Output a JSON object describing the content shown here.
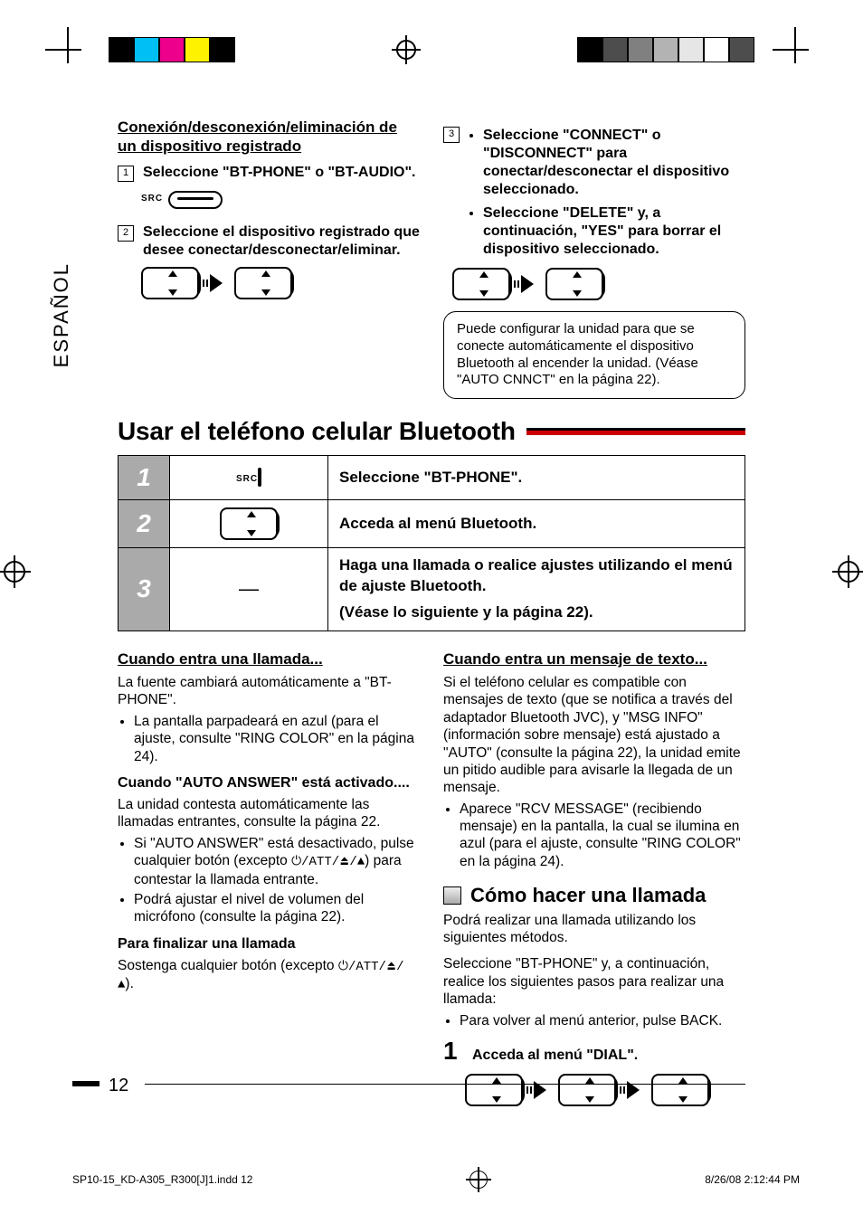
{
  "lang_tab": "ESPAÑOL",
  "top": {
    "left": {
      "heading": "Conexión/desconexión/eliminación de un dispositivo registrado",
      "steps": {
        "1": "Seleccione \"BT-PHONE\" o \"BT-AUDIO\".",
        "2": "Seleccione el dispositivo registrado que desee conectar/desconectar/eliminar."
      },
      "src_label": "SRC"
    },
    "right": {
      "step3": {
        "a": "Seleccione \"CONNECT\" o \"DISCONNECT\" para conectar/desconectar el dispositivo seleccionado.",
        "b": "Seleccione \"DELETE\" y, a continuación, \"YES\" para borrar el dispositivo seleccionado."
      },
      "note": "Puede configurar la unidad para que se conecte automáticamente el dispositivo Bluetooth al encender la unidad. (Véase \"AUTO CNNCT\" en la página 22)."
    }
  },
  "section_title": "Usar el teléfono celular Bluetooth",
  "table": {
    "1": "Seleccione \"BT-PHONE\".",
    "2": "Acceda al menú Bluetooth.",
    "3a": "Haga una llamada o realice ajustes utilizando el menú de ajuste Bluetooth.",
    "3b": "(Véase lo siguiente y la página 22).",
    "src_label": "SRC"
  },
  "lower": {
    "left": {
      "h1": "Cuando entra una llamada...",
      "p1": "La fuente cambiará automáticamente a \"BT-PHONE\".",
      "li1": "La pantalla parpadeará en azul (para el ajuste, consulte \"RING COLOR\" en la página 24).",
      "b2": "Cuando \"AUTO ANSWER\" está activado....",
      "p2": "La unidad contesta automáticamente las llamadas entrantes, consulte la página 22.",
      "li2": "Si \"AUTO ANSWER\" está desactivado, pulse cualquier botón (excepto ",
      "li2_tail": ") para contestar la llamada entrante.",
      "li3": "Podrá ajustar el nivel de volumen del micrófono (consulte la página 22).",
      "b3": "Para finalizar una llamada",
      "p3_head": "Sostenga cualquier botón (excepto ",
      "p3_tail": ").",
      "glyph": "⏻/ATT/⏏/▲"
    },
    "right": {
      "h1": "Cuando entra un mensaje de texto...",
      "p1": "Si el teléfono celular es compatible con mensajes de texto (que se notifica a través del adaptador Bluetooth JVC), y \"MSG INFO\" (información sobre mensaje) está ajustado a \"AUTO\" (consulte la página 22), la unidad emite un pitido audible para avisarle la llegada de un mensaje.",
      "li1": "Aparece \"RCV MESSAGE\" (recibiendo mensaje) en la pantalla, la cual se ilumina en azul (para el ajuste, consulte \"RING COLOR\" en la página 24).",
      "sq_title": "Cómo hacer una llamada",
      "p2": "Podrá realizar una llamada utilizando los siguientes métodos.",
      "p3": "Seleccione \"BT-PHONE\" y, a continuación, realice los siguientes pasos para realizar una llamada:",
      "li2": "Para volver al menú anterior, pulse BACK.",
      "step1_num": "1",
      "step1": "Acceda al menú \"DIAL\"."
    }
  },
  "page_number": "12",
  "imprint": {
    "file": "SP10-15_KD-A305_R300[J]1.indd   12",
    "date": "8/26/08   2:12:44 PM"
  }
}
